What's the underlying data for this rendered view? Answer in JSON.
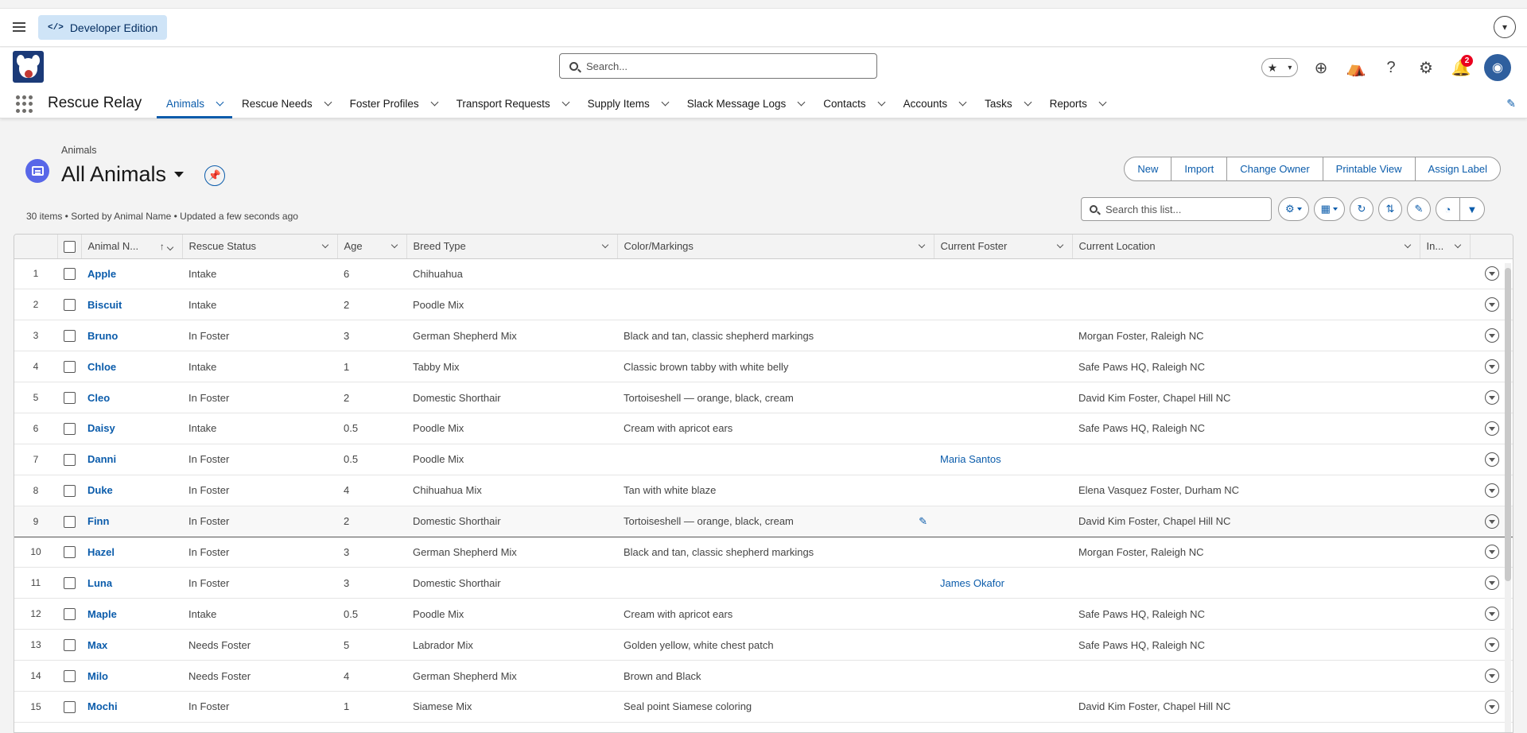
{
  "topbar": {
    "dev_badge": "Developer Edition",
    "dev_icon": "</>"
  },
  "header": {
    "search_placeholder": "Search...",
    "notification_count": "2",
    "icons": [
      "star-icon",
      "add-icon",
      "trailhead-icon",
      "help-icon",
      "setup-gear-icon",
      "bell-icon",
      "avatar"
    ]
  },
  "app": {
    "name": "Rescue Relay",
    "tabs": [
      {
        "label": "Animals",
        "active": true
      },
      {
        "label": "Rescue Needs"
      },
      {
        "label": "Foster Profiles"
      },
      {
        "label": "Transport Requests"
      },
      {
        "label": "Supply Items"
      },
      {
        "label": "Slack Message Logs"
      },
      {
        "label": "Contacts"
      },
      {
        "label": "Accounts"
      },
      {
        "label": "Tasks"
      },
      {
        "label": "Reports"
      }
    ]
  },
  "list": {
    "object": "Animals",
    "title": "All Animals",
    "meta": "30 items • Sorted by Animal Name • Updated a few seconds ago",
    "search_placeholder": "Search this list...",
    "actions": [
      "New",
      "Import",
      "Change Owner",
      "Printable View",
      "Assign Label"
    ]
  },
  "columns": [
    "Animal N...",
    "Rescue Status",
    "Age",
    "Breed Type",
    "Color/Markings",
    "Current Foster",
    "Current Location",
    "In..."
  ],
  "rows": [
    {
      "n": "1",
      "name": "Apple",
      "status": "Intake",
      "age": "6",
      "breed": "Chihuahua",
      "color": "",
      "foster": "",
      "location": ""
    },
    {
      "n": "2",
      "name": "Biscuit",
      "status": "Intake",
      "age": "2",
      "breed": "Poodle Mix",
      "color": "",
      "foster": "",
      "location": ""
    },
    {
      "n": "3",
      "name": "Bruno",
      "status": "In Foster",
      "age": "3",
      "breed": "German Shepherd Mix",
      "color": "Black and tan, classic shepherd markings",
      "foster": "",
      "location": "Morgan Foster, Raleigh NC"
    },
    {
      "n": "4",
      "name": "Chloe",
      "status": "Intake",
      "age": "1",
      "breed": "Tabby Mix",
      "color": "Classic brown tabby with white belly",
      "foster": "",
      "location": "Safe Paws HQ, Raleigh NC"
    },
    {
      "n": "5",
      "name": "Cleo",
      "status": "In Foster",
      "age": "2",
      "breed": "Domestic Shorthair",
      "color": "Tortoiseshell — orange, black, cream",
      "foster": "",
      "location": "David Kim Foster, Chapel Hill NC"
    },
    {
      "n": "6",
      "name": "Daisy",
      "status": "Intake",
      "age": "0.5",
      "breed": "Poodle Mix",
      "color": "Cream with apricot ears",
      "foster": "",
      "location": "Safe Paws HQ, Raleigh NC"
    },
    {
      "n": "7",
      "name": "Danni",
      "status": "In Foster",
      "age": "0.5",
      "breed": "Poodle Mix",
      "color": "",
      "foster": "Maria Santos",
      "location": ""
    },
    {
      "n": "8",
      "name": "Duke",
      "status": "In Foster",
      "age": "4",
      "breed": "Chihuahua Mix",
      "color": "Tan with white blaze",
      "foster": "",
      "location": "Elena Vasquez Foster, Durham NC"
    },
    {
      "n": "9",
      "name": "Finn",
      "status": "In Foster",
      "age": "2",
      "breed": "Domestic Shorthair",
      "color": "Tortoiseshell — orange, black, cream",
      "foster": "",
      "location": "David Kim Foster, Chapel Hill NC"
    },
    {
      "n": "10",
      "name": "Hazel",
      "status": "In Foster",
      "age": "3",
      "breed": "German Shepherd Mix",
      "color": "Black and tan, classic shepherd markings",
      "foster": "",
      "location": "Morgan Foster, Raleigh NC"
    },
    {
      "n": "11",
      "name": "Luna",
      "status": "In Foster",
      "age": "3",
      "breed": "Domestic Shorthair",
      "color": "",
      "foster": "James Okafor",
      "location": ""
    },
    {
      "n": "12",
      "name": "Maple",
      "status": "Intake",
      "age": "0.5",
      "breed": "Poodle Mix",
      "color": "Cream with apricot ears",
      "foster": "",
      "location": "Safe Paws HQ, Raleigh NC"
    },
    {
      "n": "13",
      "name": "Max",
      "status": "Needs Foster",
      "age": "5",
      "breed": "Labrador Mix",
      "color": "Golden yellow, white chest patch",
      "foster": "",
      "location": "Safe Paws HQ, Raleigh NC"
    },
    {
      "n": "14",
      "name": "Milo",
      "status": "Needs Foster",
      "age": "4",
      "breed": "German Shepherd Mix",
      "color": "Brown and Black",
      "foster": "",
      "location": ""
    },
    {
      "n": "15",
      "name": "Mochi",
      "status": "In Foster",
      "age": "1",
      "breed": "Siamese Mix",
      "color": "Seal point Siamese coloring",
      "foster": "",
      "location": "David Kim Foster, Chapel Hill NC"
    }
  ]
}
